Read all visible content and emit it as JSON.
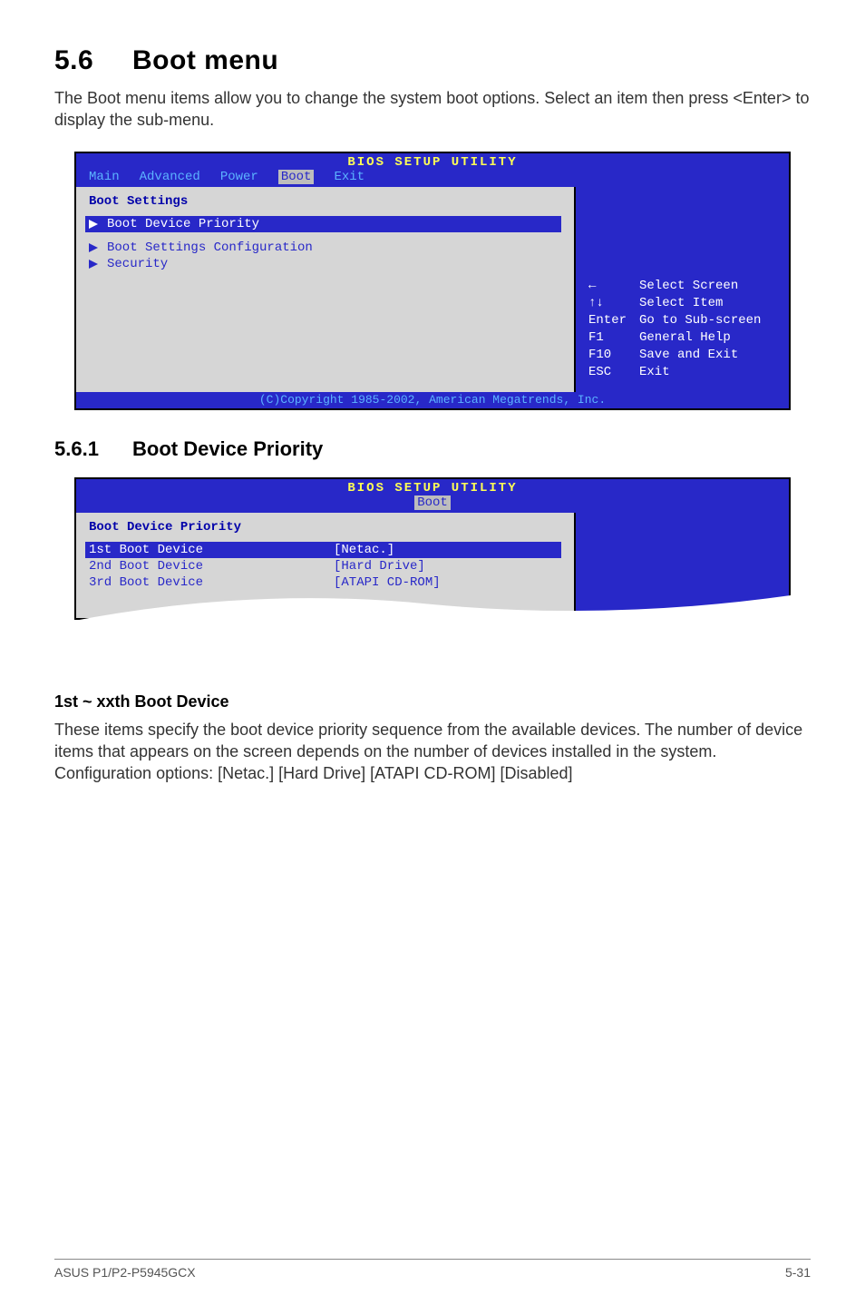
{
  "section": {
    "number": "5.6",
    "title": "Boot menu",
    "intro": "The Boot menu items allow you to change the system boot options. Select an item then press <Enter> to display the sub-menu."
  },
  "bios1": {
    "title": "BIOS SETUP UTILITY",
    "tabs": [
      "Main",
      "Advanced",
      "Power",
      "Boot",
      "Exit"
    ],
    "active_tab_index": 3,
    "pane_title": "Boot Settings",
    "items": [
      {
        "label": "Boot Device Priority",
        "selected": true
      },
      {
        "label": "Boot Settings Configuration",
        "selected": false
      },
      {
        "label": "Security",
        "selected": false
      }
    ],
    "help": [
      {
        "key": "←",
        "text": "Select Screen"
      },
      {
        "key": "↑↓",
        "text": "Select Item"
      },
      {
        "key": "Enter",
        "text": "Go to Sub-screen"
      },
      {
        "key": "F1",
        "text": "General Help"
      },
      {
        "key": "F10",
        "text": "Save and Exit"
      },
      {
        "key": "ESC",
        "text": "Exit"
      }
    ],
    "footer": "(C)Copyright 1985-2002, American Megatrends, Inc."
  },
  "subsection": {
    "number": "5.6.1",
    "title": "Boot Device Priority"
  },
  "bios2": {
    "title": "BIOS SETUP UTILITY",
    "active_tab": "Boot",
    "pane_title": "Boot Device Priority",
    "options": [
      {
        "label": "1st Boot Device",
        "value": "[Netac.]",
        "selected": true
      },
      {
        "label": "2nd Boot Device",
        "value": "[Hard Drive]",
        "selected": false
      },
      {
        "label": "3rd Boot Device",
        "value": "[ATAPI CD-ROM]",
        "selected": false
      }
    ]
  },
  "field": {
    "heading": "1st ~ xxth Boot Device",
    "body": "These items specify the boot device priority sequence from the available devices. The number of device items that appears on the screen depends on the number of devices installed in the system. Configuration options: [Netac.] [Hard Drive] [ATAPI CD-ROM] [Disabled]"
  },
  "footer": {
    "left": "ASUS P1/P2-P5945GCX",
    "right": "5-31"
  }
}
